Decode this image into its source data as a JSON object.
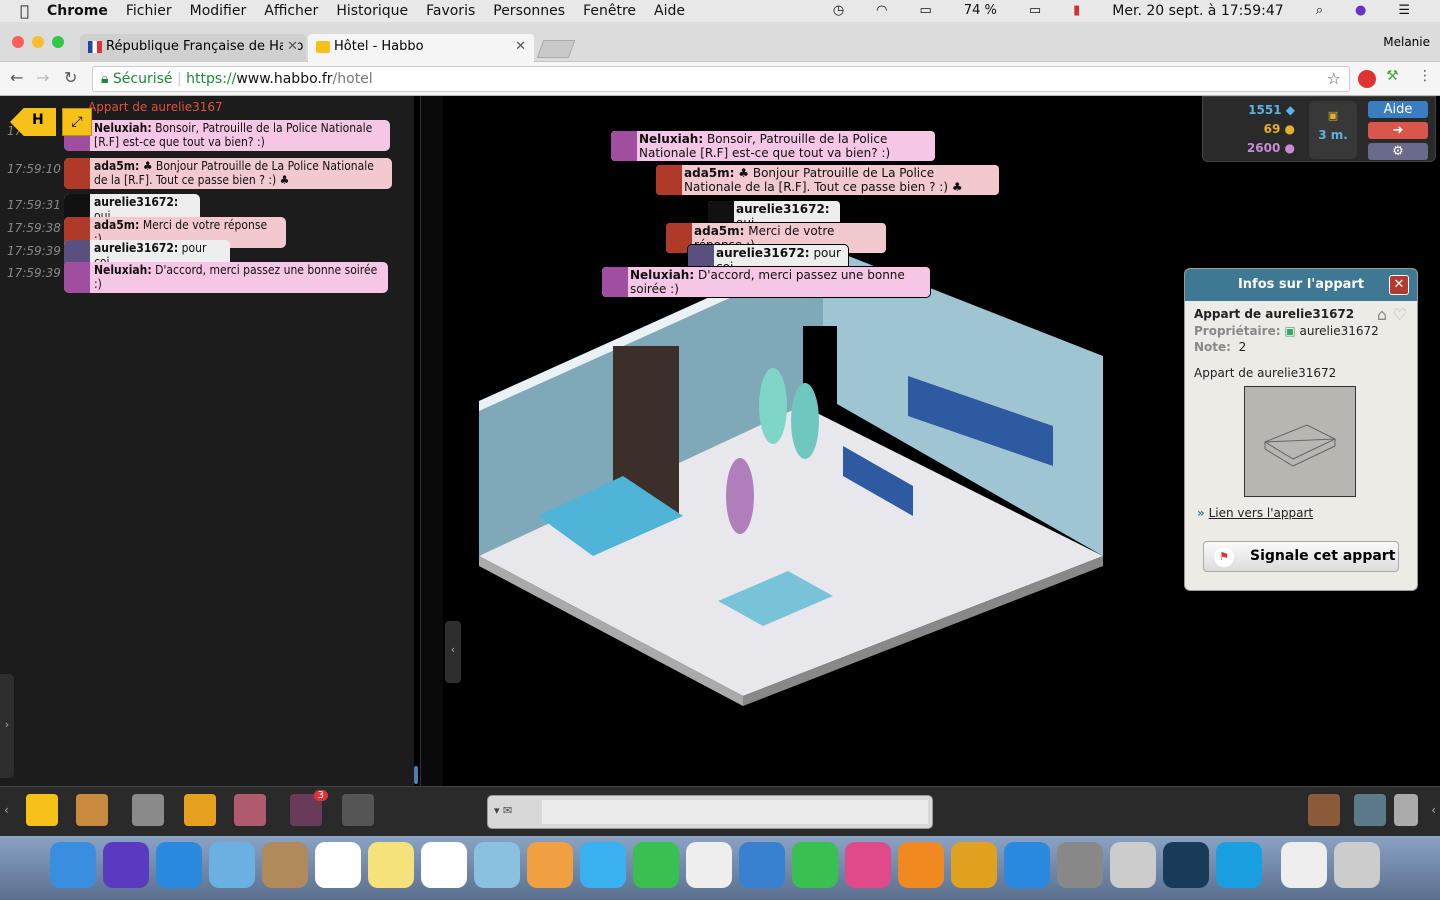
{
  "menubar": {
    "apple": "",
    "app": "Chrome",
    "items": [
      "Fichier",
      "Modifier",
      "Afficher",
      "Historique",
      "Favoris",
      "Personnes",
      "Fenêtre",
      "Aide"
    ],
    "battery": "74 %",
    "datetime": "Mer. 20 sept. à  17:59:47"
  },
  "browser": {
    "profile": "Melanie",
    "tabs": [
      {
        "title": "République Française de Habb"
      },
      {
        "title": "Hôtel - Habbo"
      }
    ],
    "secure_label": "Sécurisé",
    "url_scheme": "https://",
    "url_host": "www.habbo.fr",
    "url_path": "/hotel"
  },
  "chatlog": {
    "room_header": "Appart de aurelie3167",
    "entries": [
      {
        "time": "17:59:0",
        "user": "Neluxiah:",
        "text": "Bonsoir, Patrouille de la Police Nationale [R.F] est-ce que tout va bien? :)",
        "color": "#f5c6e6"
      },
      {
        "time": "17:59:10",
        "user": "ada5m:",
        "text": "♣ Bonjour Patrouille de La Police Nationale de la [R.F]. Tout ce passe bien ? :) ♣",
        "color": "#f3c9d0"
      },
      {
        "time": "17:59:31",
        "user": "aurelie31672:",
        "text": "oui",
        "color": "#eeeeee"
      },
      {
        "time": "17:59:38",
        "user": "ada5m:",
        "text": "Merci de votre réponse :)",
        "color": "#f3c9d0"
      },
      {
        "time": "17:59:39",
        "user": "aurelie31672:",
        "text": "pour coi",
        "color": "#eeeeee"
      },
      {
        "time": "17:59:39",
        "user": "Neluxiah:",
        "text": "D'accord, merci passez une bonne soirée :)",
        "color": "#f5c6e6"
      }
    ]
  },
  "room_bubbles": [
    {
      "user": "Neluxiah:",
      "text": "Bonsoir, Patrouille de la Police Nationale [R.F] est-ce que tout va bien? :)"
    },
    {
      "user": "ada5m:",
      "text": "♣ Bonjour Patrouille de La Police Nationale de la [R.F]. Tout ce passe bien ? :) ♣"
    },
    {
      "user": "aurelie31672:",
      "text": "oui"
    },
    {
      "user": "ada5m:",
      "text": "Merci de votre réponse :)"
    },
    {
      "user": "aurelie31672:",
      "text": "pour coi"
    },
    {
      "user": "Neluxiah:",
      "text": "D'accord, merci passez une bonne soirée :)"
    }
  ],
  "hud": {
    "diamonds": "1551",
    "credits": "69",
    "duckets": "2600",
    "hc_time": "3 m.",
    "help": "Aide",
    "colors": {
      "help": "#3a7dc0",
      "exit": "#d9574a",
      "settings": "#6a6a8a"
    }
  },
  "room_info": {
    "title": "Infos sur l'appart",
    "name": "Appart de aurelie31672",
    "owner_label": "Propriétaire:",
    "owner": "aurelie31672",
    "rating_label": "Note:",
    "rating": "2",
    "description": "Appart de aurelie31672",
    "link": "Lien vers l'appart",
    "report": "Signale cet appart"
  },
  "toolbar": {
    "messenger_badge": "3",
    "chat_input": ""
  }
}
